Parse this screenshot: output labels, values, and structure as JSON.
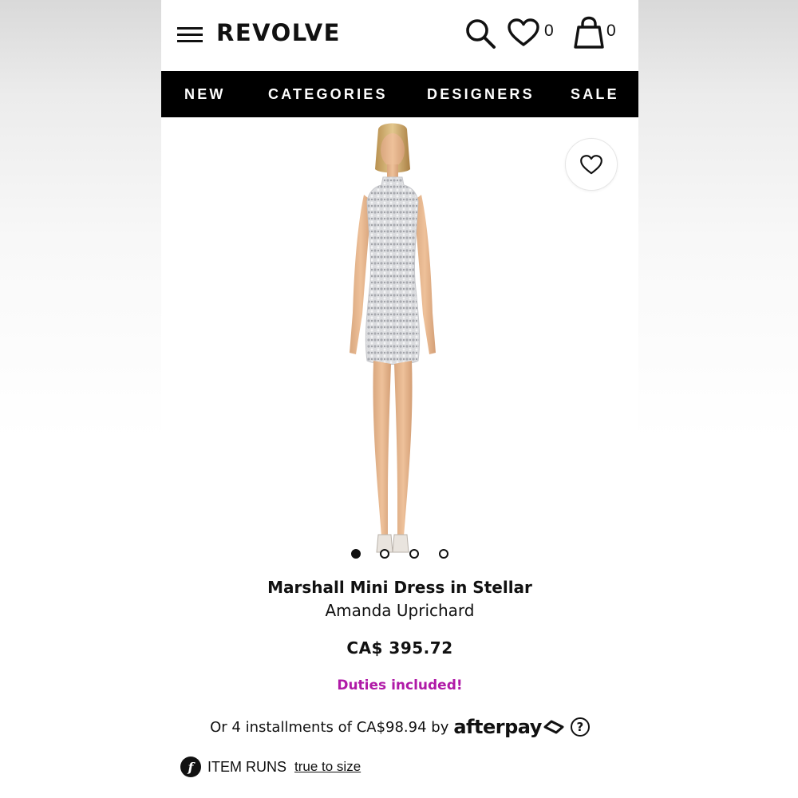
{
  "header": {
    "logo": "REVOLVE",
    "wishlist_count": "0",
    "bag_count": "0",
    "icons": [
      "menu-icon",
      "search-icon",
      "heart-icon",
      "shopping-bag-icon"
    ]
  },
  "nav": {
    "items": [
      {
        "label": "NEW"
      },
      {
        "label": "CATEGORIES"
      },
      {
        "label": "DESIGNERS"
      },
      {
        "label": "SALE"
      }
    ]
  },
  "gallery": {
    "image_count": 4,
    "active_index": 0,
    "favorite_icon": "heart-outline-icon"
  },
  "product": {
    "name": "Marshall Mini Dress in Stellar",
    "designer": "Amanda Uprichard",
    "price": "CA$ 395.72",
    "duties_note": "Duties included!",
    "installments_text": "Or 4 installments of CA$98.94 by",
    "afterpay_brand": "afterpay",
    "help_glyph": "?",
    "fit_label": "ITEM RUNS",
    "fit_value": "true to size",
    "fit_icon_glyph": "f"
  },
  "colors": {
    "nav_bg": "#000000",
    "duties": "#b01aa7",
    "text": "#111111"
  }
}
